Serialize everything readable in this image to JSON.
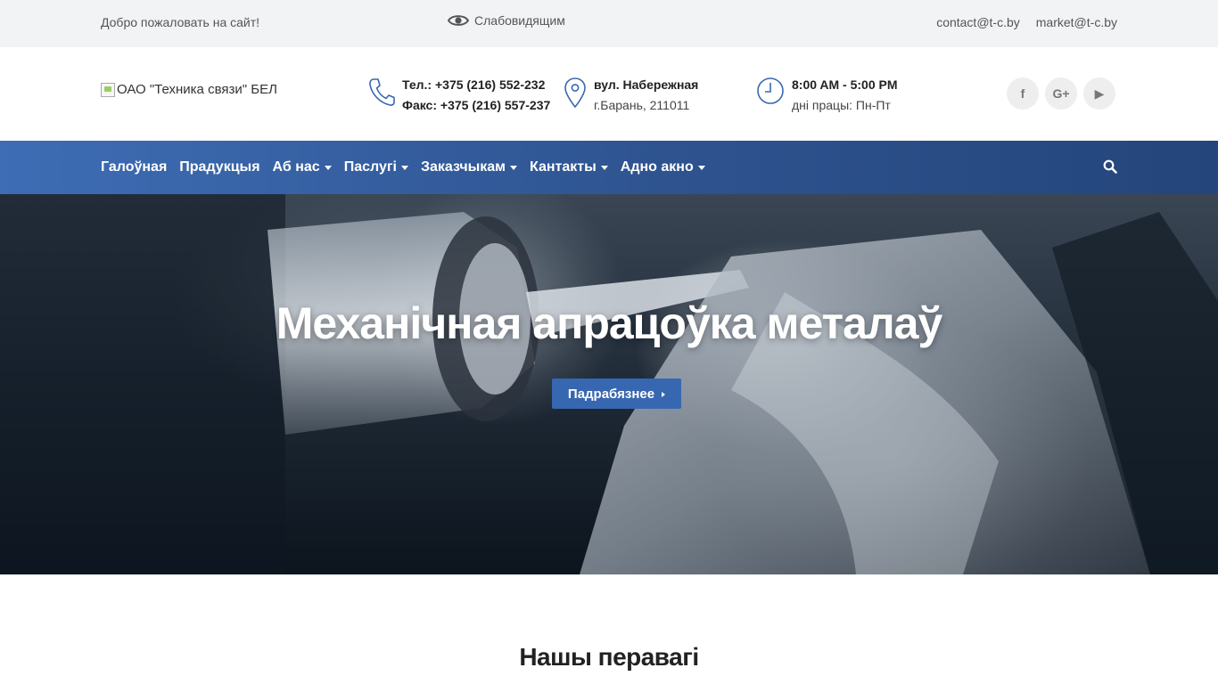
{
  "topbar": {
    "welcome": "Добро пожаловать на сайт!",
    "low_vision": "Слабовидящим",
    "emails": [
      "contact@t-c.by",
      "market@t-c.by"
    ]
  },
  "header": {
    "logo_alt": "ОАО \"Техника связи\" БЕЛ",
    "phone": {
      "line1": "Тел.: +375 (216) 552-232",
      "line2": "Факс: +375 (216) 557-237",
      "icon": "phone-icon"
    },
    "address": {
      "line1": "вул. Набережная",
      "line2": "г.Барань, 211011",
      "icon": "map-pin-icon"
    },
    "hours": {
      "line1": "8:00 AM - 5:00 PM",
      "line2": "дні працы: Пн-Пт",
      "icon": "clock-icon"
    },
    "social": [
      {
        "name": "facebook-icon",
        "glyph": "f"
      },
      {
        "name": "google-plus-icon",
        "glyph": "G+"
      },
      {
        "name": "youtube-icon",
        "glyph": "▶"
      }
    ]
  },
  "nav": {
    "items": [
      {
        "label": "Галоўная",
        "dropdown": false
      },
      {
        "label": "Прадукцыя",
        "dropdown": false
      },
      {
        "label": "Аб нас",
        "dropdown": true
      },
      {
        "label": "Паслугі",
        "dropdown": true
      },
      {
        "label": "Заказчыкам",
        "dropdown": true
      },
      {
        "label": "Кантакты",
        "dropdown": true
      },
      {
        "label": "Адно акно",
        "dropdown": true
      }
    ],
    "search_icon": "search-icon"
  },
  "hero": {
    "title": "Механічная апрацоўка металаў",
    "button_label": "Падрабязнее"
  },
  "section": {
    "title": "Нашы перавагі"
  },
  "colors": {
    "nav_start": "#3e6db5",
    "nav_end": "#24457b",
    "button": "#3867b1",
    "topbar_bg": "#f2f3f5"
  }
}
